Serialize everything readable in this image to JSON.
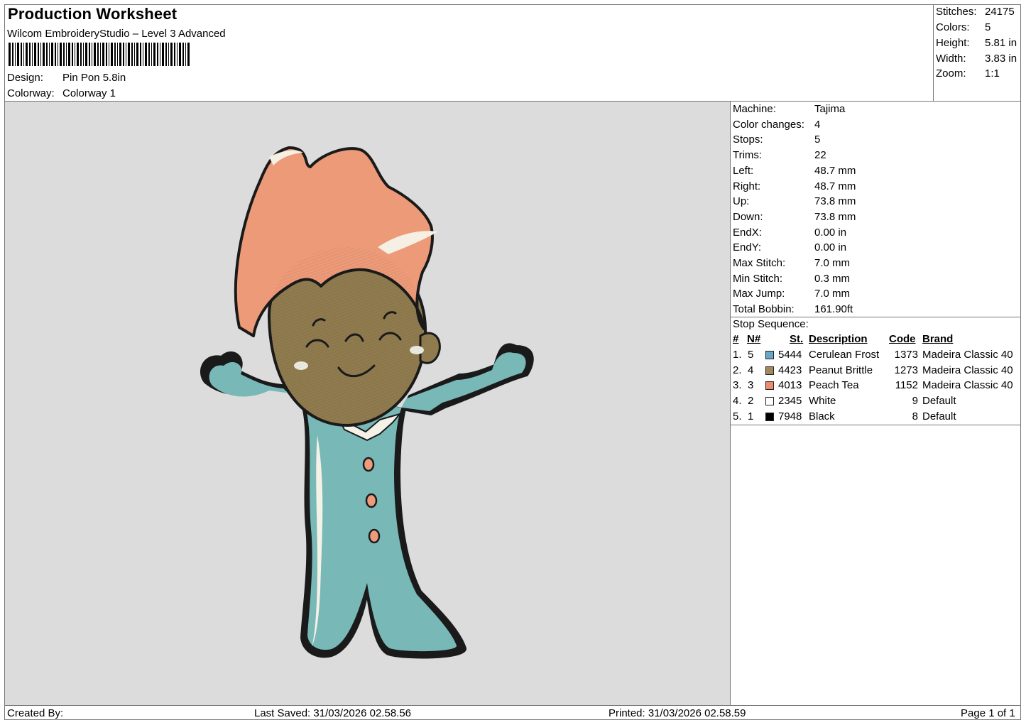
{
  "header": {
    "title": "Production Worksheet",
    "software": "Wilcom EmbroideryStudio – Level 3 Advanced",
    "design_label": "Design:",
    "design_value": "Pin Pon 5.8in",
    "colorway_label": "Colorway:",
    "colorway_value": "Colorway 1"
  },
  "stats": {
    "stitches_label": "Stitches:",
    "stitches_value": "24175",
    "colors_label": "Colors:",
    "colors_value": "5",
    "height_label": "Height:",
    "height_value": "5.81 in",
    "width_label": "Width:",
    "width_value": "3.83 in",
    "zoom_label": "Zoom:",
    "zoom_value": "1:1"
  },
  "machine_info": [
    {
      "label": "Machine:",
      "value": "Tajima"
    },
    {
      "label": "Color changes:",
      "value": "4"
    },
    {
      "label": "Stops:",
      "value": "5"
    },
    {
      "label": "Trims:",
      "value": "22"
    },
    {
      "label": "Left:",
      "value": "48.7 mm"
    },
    {
      "label": "Right:",
      "value": "48.7 mm"
    },
    {
      "label": "Up:",
      "value": "73.8 mm"
    },
    {
      "label": "Down:",
      "value": "73.8 mm"
    },
    {
      "label": "EndX:",
      "value": "0.00 in"
    },
    {
      "label": "EndY:",
      "value": "0.00 in"
    },
    {
      "label": "Max Stitch:",
      "value": "7.0 mm"
    },
    {
      "label": "Min Stitch:",
      "value": "0.3 mm"
    },
    {
      "label": "Max Jump:",
      "value": "7.0 mm"
    },
    {
      "label": "Total Bobbin:",
      "value": "161.90ft"
    }
  ],
  "stop_sequence": {
    "title": "Stop Sequence:",
    "headers": {
      "num": "#",
      "n": "N#",
      "st": "St.",
      "description": "Description",
      "code": "Code",
      "brand": "Brand"
    },
    "rows": [
      {
        "num": "1.",
        "n": "5",
        "color": "#6aa6c9",
        "st": "5444",
        "description": "Cerulean Frost",
        "code": "1373",
        "brand": "Madeira Classic 40"
      },
      {
        "num": "2.",
        "n": "4",
        "color": "#a08860",
        "st": "4423",
        "description": "Peanut Brittle",
        "code": "1273",
        "brand": "Madeira Classic 40"
      },
      {
        "num": "3.",
        "n": "3",
        "color": "#f08a6e",
        "st": "4013",
        "description": "Peach Tea",
        "code": "1152",
        "brand": "Madeira Classic 40"
      },
      {
        "num": "4.",
        "n": "2",
        "color": "#ffffff",
        "st": "2345",
        "description": "White",
        "code": "9",
        "brand": "Default"
      },
      {
        "num": "5.",
        "n": "1",
        "color": "#000000",
        "st": "7948",
        "description": "Black",
        "code": "8",
        "brand": "Default"
      }
    ]
  },
  "footer": {
    "created_by": "Created By:",
    "last_saved": "Last Saved: 31/03/2026 02.58.56",
    "printed": "Printed: 31/03/2026 02.58.59",
    "page": "Page 1 of 1"
  },
  "design_preview": {
    "colors": {
      "outline": "#1a1a1a",
      "suit": "#78b8b6",
      "suit_highlight": "#f4f1e6",
      "skin": "#8f7b4e",
      "hair": "#ec9a78",
      "hair_highlight": "#f6efe4",
      "buttons": "#ee9a7c",
      "cheek": "#ecebe2",
      "background": "#dcdcdc"
    }
  }
}
